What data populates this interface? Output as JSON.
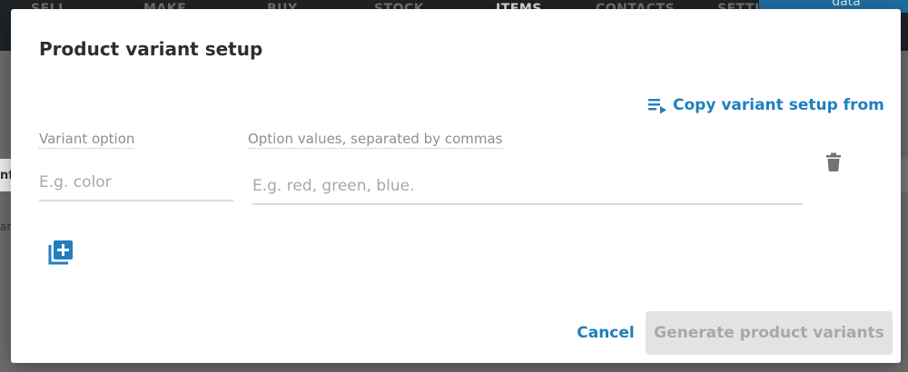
{
  "background": {
    "nav_items": [
      "SELL",
      "MAKE",
      "BUY",
      "STOCK",
      "ITEMS",
      "CONTACTS",
      "SETTI"
    ],
    "active_nav": "ITEMS",
    "nav_button": "data",
    "left_text_1": "nf",
    "left_text_2": "an"
  },
  "dialog": {
    "title": "Product variant setup",
    "copy_link": "Copy variant setup from",
    "variant_option": {
      "label": "Variant option",
      "placeholder": "E.g. color",
      "value": ""
    },
    "option_values": {
      "label": "Option values, separated by commas",
      "placeholder": "E.g. red, green, blue.",
      "value": ""
    },
    "cancel_label": "Cancel",
    "generate_label": "Generate product variants"
  },
  "colors": {
    "accent": "#1f7fbf",
    "disabled_bg": "#e3e3e3",
    "disabled_text": "#a8a8a8"
  },
  "icons": {
    "copy": "playlist-arrow-icon",
    "delete": "trash-icon",
    "add": "add-to-library-icon"
  }
}
